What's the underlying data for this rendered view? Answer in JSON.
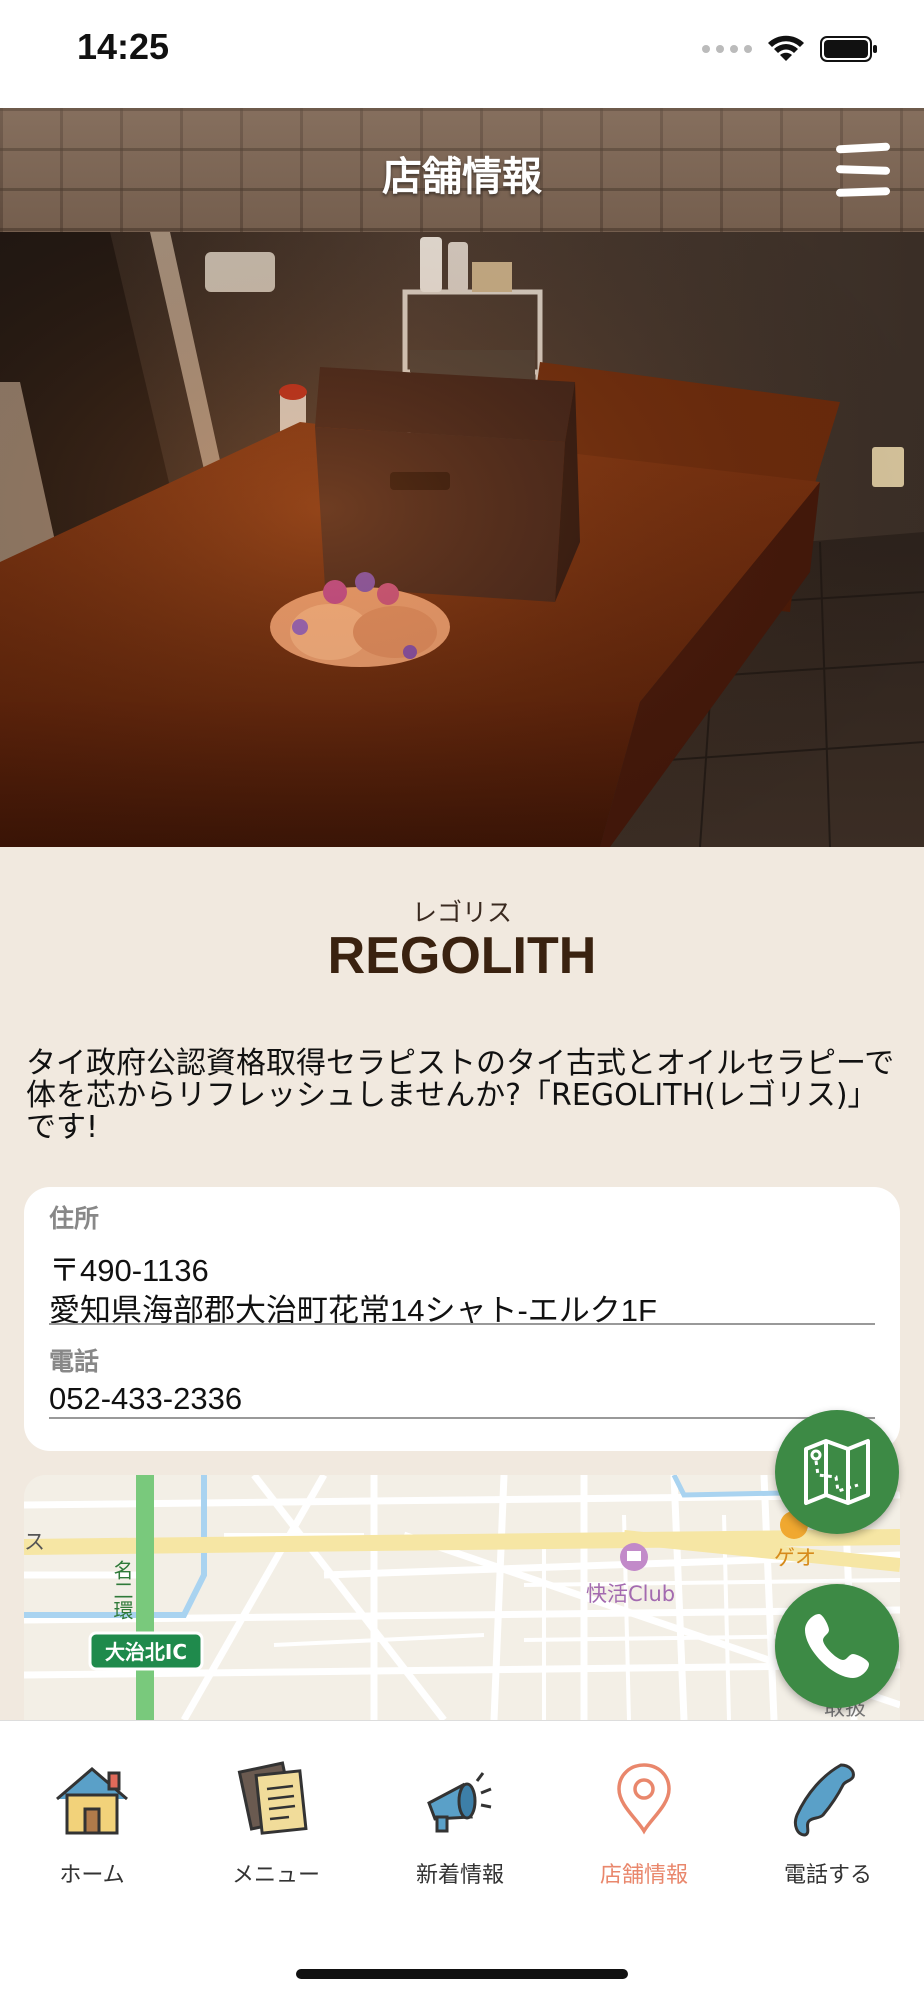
{
  "status_bar": {
    "time": "14:25"
  },
  "header": {
    "title": "店舗情報"
  },
  "shop": {
    "ruby": "レゴリス",
    "name": "REGOLITH",
    "description": "タイ政府公認資格取得セラピストのタイ古式とオイルセラピーで体を芯からリフレッシュしませんか?「REGOLITH(レゴリス)」です!"
  },
  "info": {
    "address_label": "住所",
    "postal": "〒490-1136",
    "address": "愛知県海部郡大治町花常14シャト-エルク1F",
    "phone_label": "電話",
    "phone": "052-433-2336"
  },
  "map": {
    "labels": {
      "road": "名二環",
      "ic": "大治北IC",
      "poi1": "快活Club",
      "poi2": "ゲオ",
      "edge_left": "ス",
      "edge_bottom": "取扱"
    }
  },
  "nav": {
    "items": [
      {
        "label": "ホーム",
        "icon": "home-icon"
      },
      {
        "label": "メニュー",
        "icon": "menu-doc-icon"
      },
      {
        "label": "新着情報",
        "icon": "megaphone-icon"
      },
      {
        "label": "店舗情報",
        "icon": "map-pin-icon",
        "active": true
      },
      {
        "label": "電話する",
        "icon": "phone-icon"
      }
    ]
  },
  "colors": {
    "accent_active": "#e9876c",
    "fab_green": "#3d8a45",
    "background": "#f1e9df"
  }
}
